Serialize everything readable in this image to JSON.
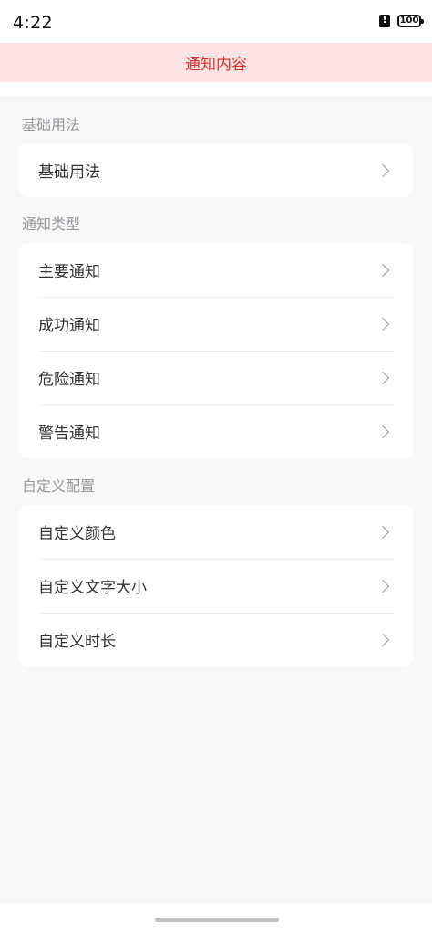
{
  "status_bar": {
    "time": "4:22",
    "battery": "100"
  },
  "notify": {
    "text": "通知内容",
    "color": "#e0302d",
    "background": "#fce4e4"
  },
  "groups": [
    {
      "title": "基础用法",
      "items": [
        {
          "label": "基础用法",
          "icon": "chevron-right-icon"
        }
      ]
    },
    {
      "title": "通知类型",
      "items": [
        {
          "label": "主要通知",
          "icon": "chevron-right-icon"
        },
        {
          "label": "成功通知",
          "icon": "chevron-right-icon"
        },
        {
          "label": "危险通知",
          "icon": "chevron-right-icon"
        },
        {
          "label": "警告通知",
          "icon": "chevron-right-icon"
        }
      ]
    },
    {
      "title": "自定义配置",
      "items": [
        {
          "label": "自定义颜色",
          "icon": "chevron-right-icon"
        },
        {
          "label": "自定义文字大小",
          "icon": "chevron-right-icon"
        },
        {
          "label": "自定义时长",
          "icon": "chevron-right-icon"
        }
      ]
    }
  ]
}
